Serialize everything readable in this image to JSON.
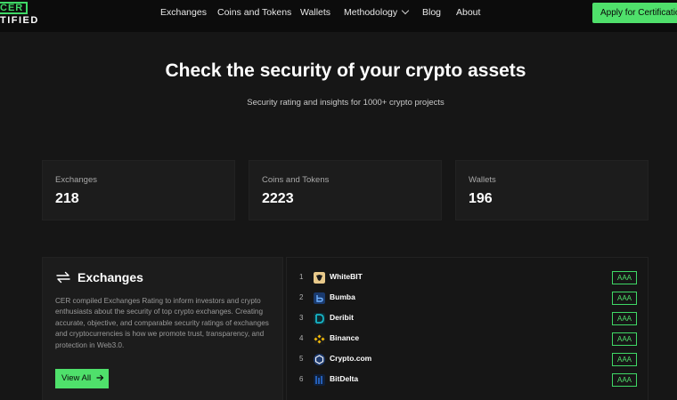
{
  "header": {
    "logo_top": "CER",
    "logo_bottom": "TIFIED",
    "nav": [
      "Exchanges",
      "Coins and Tokens",
      "Wallets",
      "Methodology",
      "Blog",
      "About"
    ],
    "cta_label": "Apply for Certification"
  },
  "hero": {
    "title": "Check the security of your crypto assets",
    "subtitle": "Security rating and insights for 1000+ crypto projects"
  },
  "stats": [
    {
      "label": "Exchanges",
      "value": "218"
    },
    {
      "label": "Coins and Tokens",
      "value": "2223"
    },
    {
      "label": "Wallets",
      "value": "196"
    }
  ],
  "exchanges_panel": {
    "title": "Exchanges",
    "description": "CER compiled Exchanges Rating to inform investors and crypto enthusiasts about the security of top crypto exchanges. Creating accurate, objective, and comparable security ratings of exchanges and cryptocurrencies is how we promote trust, transparency, and protection in Web3.0.",
    "button_label": "View All",
    "button_icon": "arrow-right-icon"
  },
  "ranking": [
    {
      "rank": "1",
      "name": "WhiteBIT",
      "rating": "AAA",
      "logo_color": "#e8c98a"
    },
    {
      "rank": "2",
      "name": "Bumba",
      "rating": "AAA",
      "logo_color": "#1a3a6e"
    },
    {
      "rank": "3",
      "name": "Deribit",
      "rating": "AAA",
      "logo_color": "#17b6c7"
    },
    {
      "rank": "4",
      "name": "Binance",
      "rating": "AAA",
      "logo_color": "#f0b90b"
    },
    {
      "rank": "5",
      "name": "Crypto.com",
      "rating": "AAA",
      "logo_color": "#1f3b6e"
    },
    {
      "rank": "6",
      "name": "BitDelta",
      "rating": "AAA",
      "logo_color": "#2b6fd6"
    }
  ],
  "colors": {
    "accent": "#4fe06b",
    "background": "#161616",
    "card": "#1c1c1c"
  }
}
